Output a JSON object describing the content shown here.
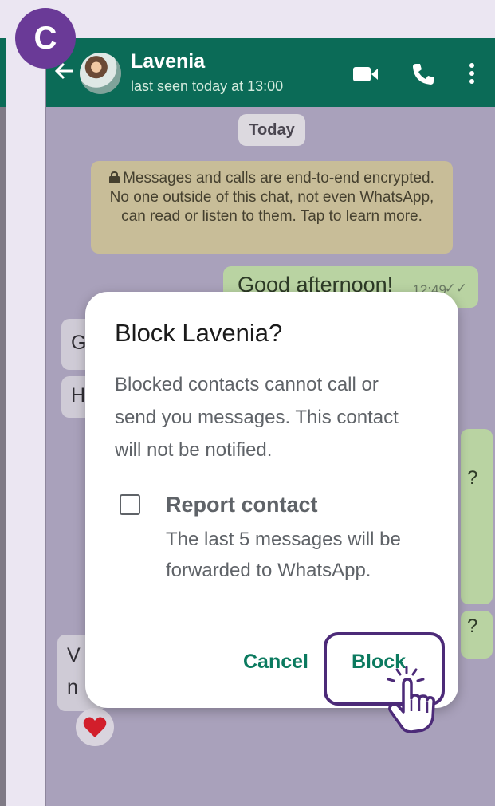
{
  "step_badge": "C",
  "chat": {
    "contact_name": "Lavenia",
    "last_seen": "last seen today at 13:00",
    "date_chip": "Today",
    "encryption_notice": "Messages and calls are end-to-end encrypted. No one outside of this chat, not even WhatsApp, can read or listen to them. Tap to learn more.",
    "outgoing_message": "Good afternoon!",
    "outgoing_time": "12:49",
    "incoming_partial_1": "G",
    "incoming_partial_2": "H",
    "incoming_partial_3a": "V",
    "incoming_partial_3b": "n",
    "outgoing_partial_1": "?",
    "outgoing_partial_2": "?"
  },
  "dialog": {
    "title": "Block Lavenia?",
    "body": "Blocked contacts cannot call or send you messages. This contact will not be notified.",
    "checkbox_label": "Report contact",
    "checkbox_checked": false,
    "checkbox_description": "The last 5 messages will be forwarded to WhatsApp.",
    "cancel_label": "Cancel",
    "block_label": "Block"
  },
  "icons": {
    "back": "back-arrow-icon",
    "video": "video-call-icon",
    "phone": "voice-call-icon",
    "menu": "more-options-icon",
    "lock": "lock-icon",
    "reaction": "heart-icon",
    "pointer": "hand-pointer-icon"
  },
  "colors": {
    "header_green": "#0b6b57",
    "accent_purple": "#6a3a97",
    "button_green": "#0b7a5f"
  }
}
